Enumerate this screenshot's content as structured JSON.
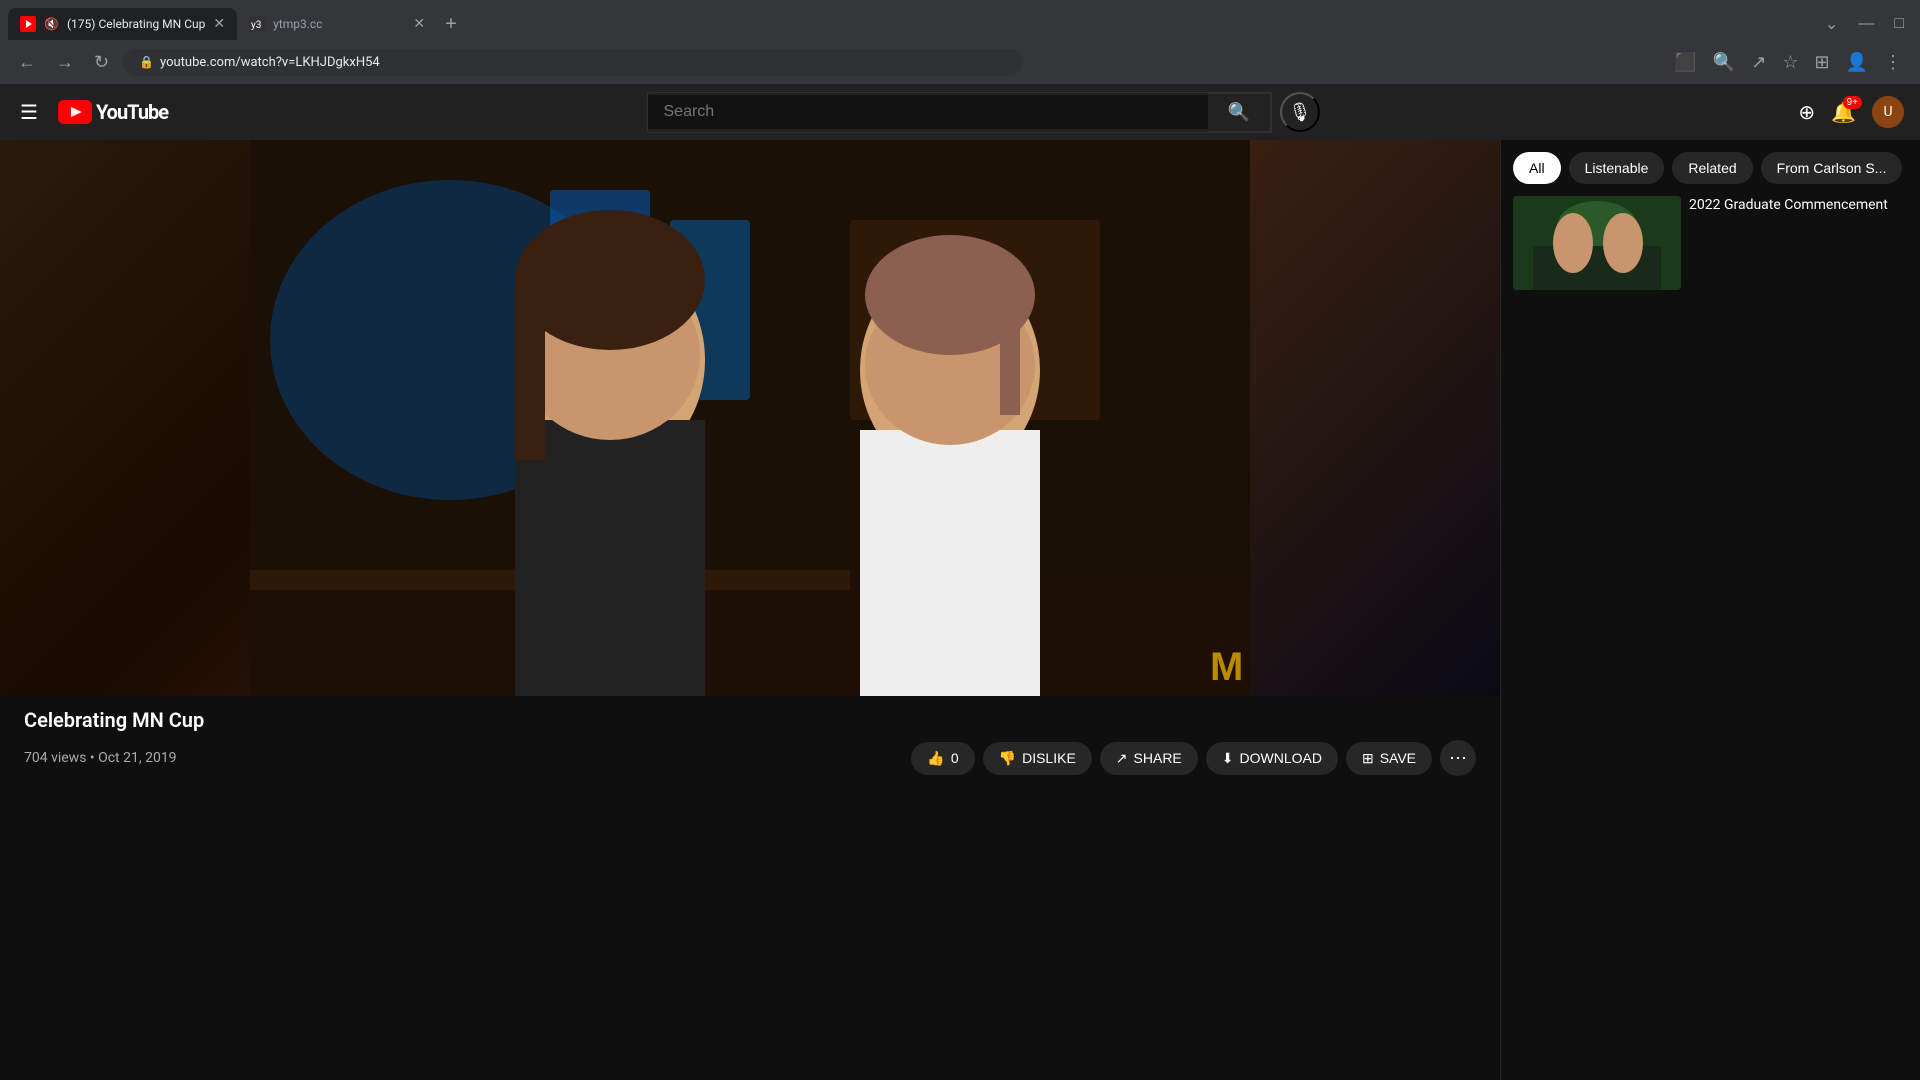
{
  "browser": {
    "tabs": [
      {
        "id": "tab1",
        "title": "(175) Celebrating MN Cup",
        "url": "youtube.com/watch?v=LKHJDgkxH54",
        "active": true,
        "favicon": "yt",
        "muted": true
      },
      {
        "id": "tab2",
        "title": "ytmp3.cc",
        "url": "ytmp3.cc",
        "active": false,
        "favicon": "yt3"
      }
    ],
    "url": "youtube.com/watch?v=LKHJDgkxH54",
    "full_url": "https://youtube.com/watch?v=LKHJDgkxH54"
  },
  "youtube": {
    "logo_text": "YouTube",
    "search_placeholder": "Search",
    "video": {
      "title": "Celebrating MN Cup",
      "views": "704 views",
      "date": "Oct 21, 2019",
      "views_date": "704 views • Oct 21, 2019",
      "likes": "0",
      "watermark": "M"
    },
    "actions": {
      "like": "0",
      "dislike": "DISLIKE",
      "share": "SHARE",
      "download": "DOWNLOAD",
      "save": "SAVE"
    },
    "filter_tabs": [
      {
        "label": "All",
        "active": true
      },
      {
        "label": "Listenable",
        "active": false
      },
      {
        "label": "Related",
        "active": false
      },
      {
        "label": "From Carlson S...",
        "active": false
      }
    ],
    "notification_count": "9+",
    "related_videos": [
      {
        "title": "2022 Graduate Commencement",
        "channel": "",
        "meta": ""
      }
    ]
  }
}
